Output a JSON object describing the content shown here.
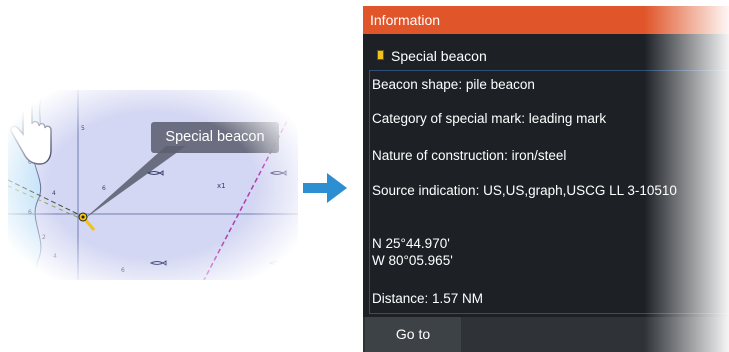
{
  "chart": {
    "callout_label": "Special beacon",
    "tap_count": "x1",
    "soundings": [
      "5",
      "4",
      "6",
      "4",
      "6",
      "6",
      "2",
      "6"
    ],
    "icons": [
      "map-chart-icon",
      "beacon-icon",
      "fish-icon",
      "hand-pointer-icon"
    ]
  },
  "arrow_icon": "right-arrow-icon",
  "info_panel": {
    "title": "Information",
    "object_name": "Special beacon",
    "object_icon": "beacon-icon",
    "lines": {
      "shape": "Beacon shape: pile beacon",
      "category": "Category of special mark: leading mark",
      "construction": "Nature of construction: iron/steel",
      "source": "Source indication: US,US,graph,USCG LL 3-10510",
      "lat": "N  25°44.970'",
      "lon": "W  80°05.965'",
      "distance": "Distance: 1.57 NM"
    },
    "goto_label": "Go to"
  },
  "colors": {
    "title_bar": "#e05529",
    "panel_bg": "#1d2126",
    "chart_water": "#d4d7f3",
    "chart_shallow": "#bfe0f7",
    "arrow": "#2b8fd1",
    "track_line": "#b23bb3",
    "beacon": "#f1c21d"
  }
}
